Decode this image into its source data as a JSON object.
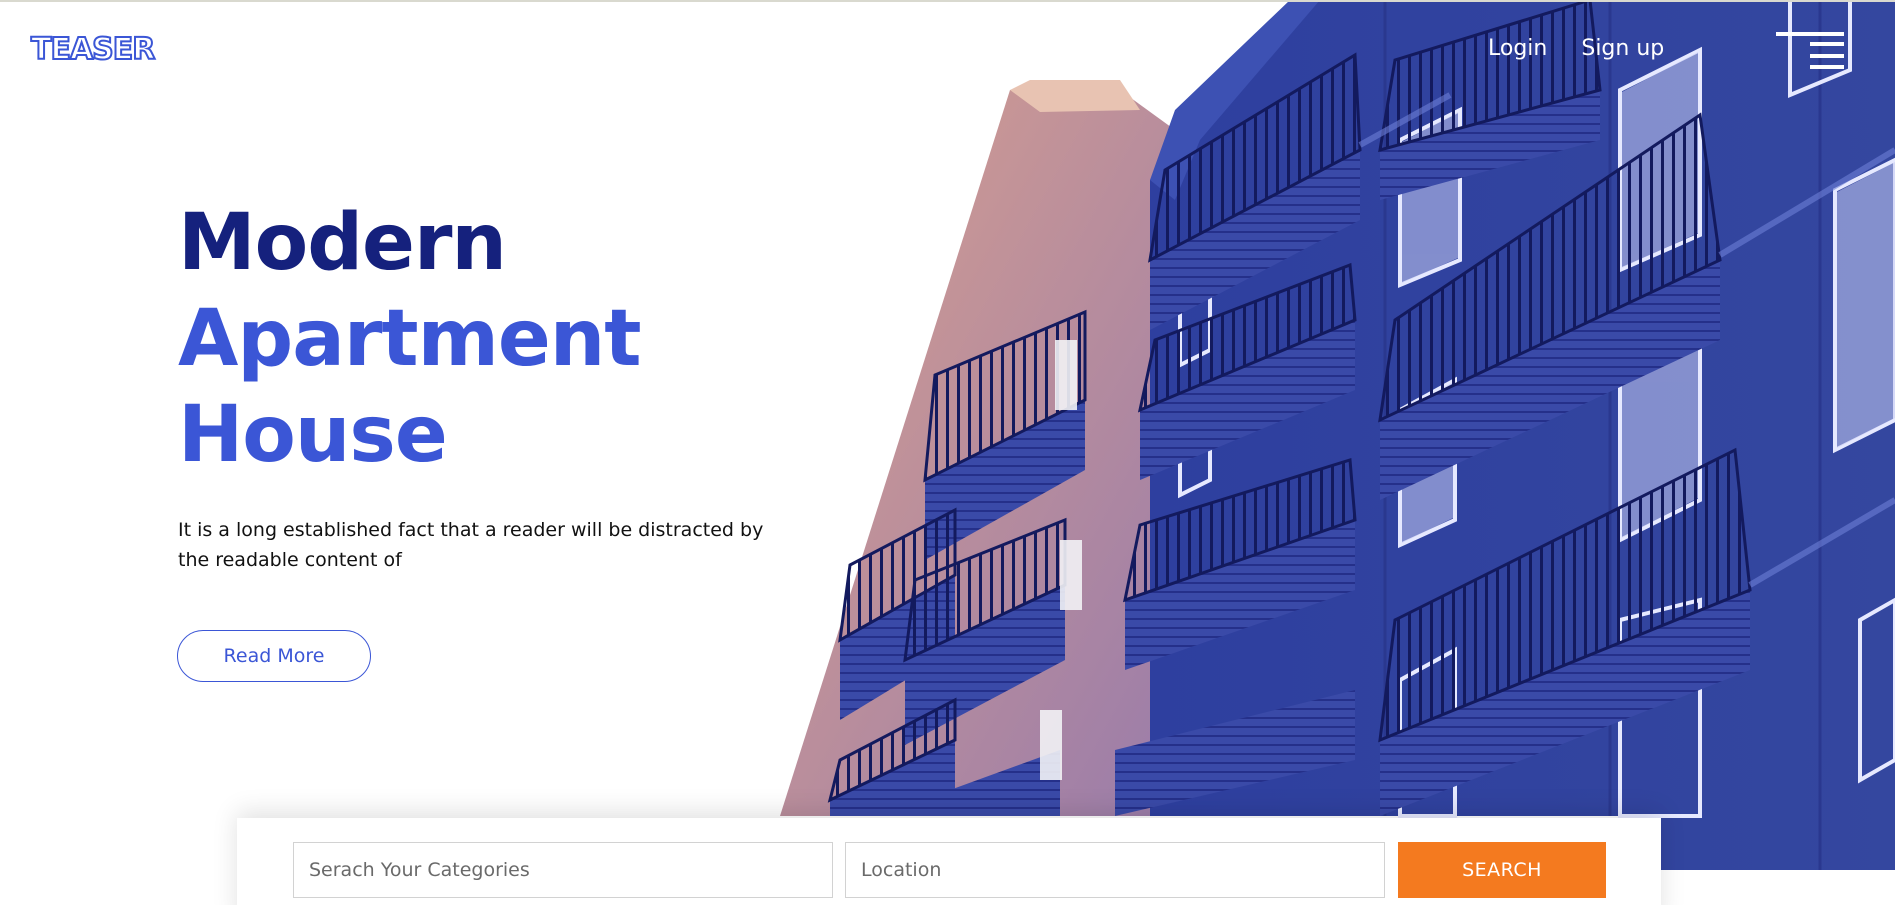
{
  "header": {
    "logo_text": "TEASER",
    "nav": {
      "login_label": "Login",
      "signup_label": "Sign up"
    },
    "menu_icon": "hamburger-menu-icon"
  },
  "hero": {
    "title_line1": "Modern",
    "title_line2": "Apartment",
    "title_line3": "House",
    "description": "It is a long established fact that a reader will be distracted by the readable content of",
    "read_more_label": "Read More",
    "image": "apartment-building-photo"
  },
  "search": {
    "category_placeholder": "Serach Your Categories",
    "location_placeholder": "Location",
    "button_label": "SEARCH"
  },
  "colors": {
    "brand_blue": "#3b56d6",
    "navy": "#15217d",
    "building_blue": "#2b3c9c",
    "accent_orange": "#f47a1f",
    "text_dark": "#111111"
  }
}
